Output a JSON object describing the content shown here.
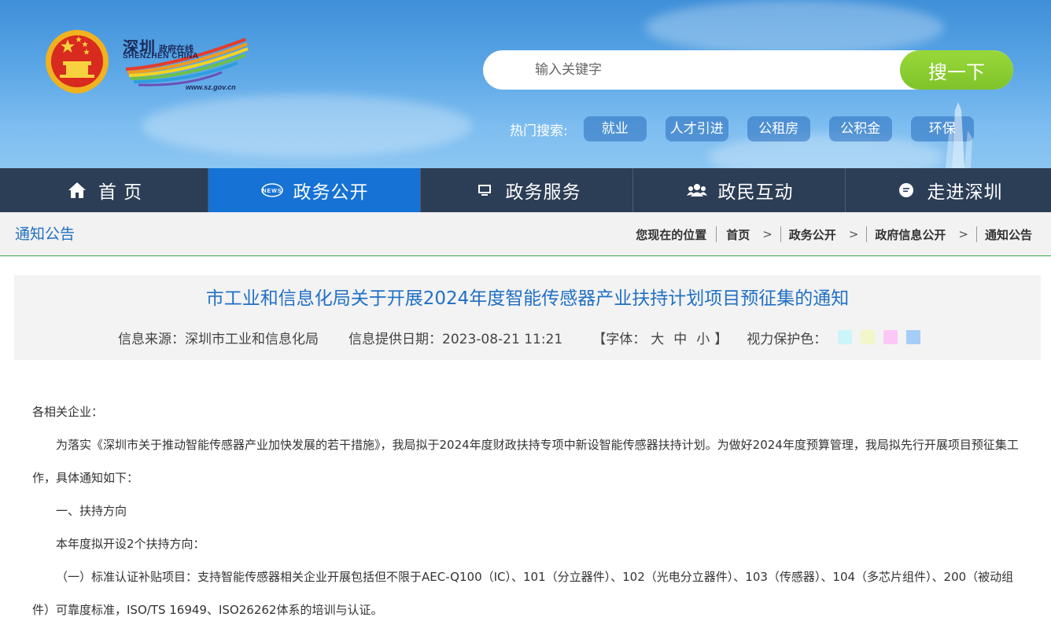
{
  "site": {
    "logo_cn": "深圳",
    "logo_cn_sub": "政府在线",
    "logo_en": "SHENZHEN CHINA",
    "logo_url": "www.sz.gov.cn"
  },
  "search": {
    "placeholder": "输入关键字",
    "button_label": "搜一下"
  },
  "hot_search": {
    "label": "热门搜索:",
    "tags": [
      "就业",
      "人才引进",
      "公租房",
      "公积金",
      "环保"
    ]
  },
  "nav": {
    "items": [
      {
        "label": "首 页",
        "icon": "home-icon",
        "active": false
      },
      {
        "label": "政务公开",
        "icon": "news-icon",
        "active": true
      },
      {
        "label": "政务服务",
        "icon": "monitor-icon",
        "active": false
      },
      {
        "label": "政民互动",
        "icon": "users-icon",
        "active": false
      },
      {
        "label": "走进深圳",
        "icon": "chat-icon",
        "active": false
      }
    ]
  },
  "breadcrumb": {
    "section_title": "通知公告",
    "location_label": "您现在的位置",
    "items": [
      "首页",
      "政务公开",
      "政府信息公开",
      "通知公告"
    ]
  },
  "article": {
    "title": "市工业和信息化局关于开展2024年度智能传感器产业扶持计划项目预征集的通知",
    "source": "信息来源：深圳市工业和信息化局",
    "date": "信息提供日期：2023-08-21 11:21",
    "font_open": "【字体：",
    "font_large": "大",
    "font_medium": "中",
    "font_small": "小",
    "font_close": "】",
    "eye_care_label": "视力保护色：",
    "eye_care_colors": [
      "#ccf5fa",
      "#f3f6c8",
      "#fbc8f6",
      "#a6cdf7"
    ],
    "paragraphs": [
      "各相关企业：",
      "为落实《深圳市关于推动智能传感器产业加快发展的若干措施》，我局拟于2024年度财政扶持专项中新设智能传感器扶持计划。为做好2024年度预算管理，我局拟先行开展项目预征集工作，具体通知如下：",
      "一、扶持方向",
      "本年度拟开设2个扶持方向：",
      "（一）标准认证补贴项目：支持智能传感器相关企业开展包括但不限于AEC-Q100（IC）、101（分立器件）、102（光电分立器件）、103（传感器）、104（多芯片组件）、200（被动组件）可靠度标准，ISO/TS 16949、ISO26262体系的培训与认证。"
    ]
  },
  "colors": {
    "nav_bg": "#2c3e56",
    "nav_active": "#1672d4",
    "link_blue": "#2170c5",
    "search_green": "#8ccd32"
  }
}
